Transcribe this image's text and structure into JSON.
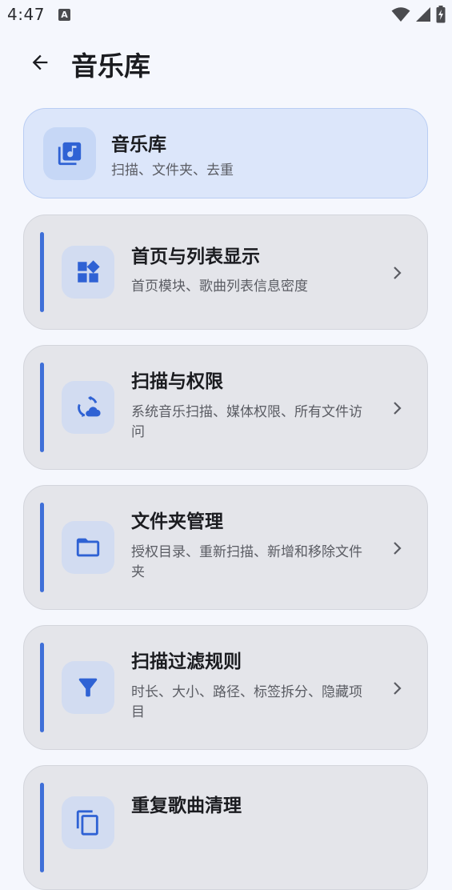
{
  "status_bar": {
    "time": "4:47",
    "notification_letter": "A",
    "icons": [
      "wifi-icon",
      "cellular-signal-icon",
      "battery-charging-icon"
    ]
  },
  "app_bar": {
    "back_icon": "arrow-left-icon",
    "title": "音乐库"
  },
  "accent_color": "#3f6fd8",
  "cards": [
    {
      "title": "音乐库",
      "subtitle": "扫描、文件夹、去重",
      "icon": "music-library-icon",
      "active": true,
      "chevron": false
    },
    {
      "title": "首页与列表显示",
      "subtitle": "首页模块、歌曲列表信息密度",
      "icon": "widgets-icon",
      "active": false,
      "chevron": true
    },
    {
      "title": "扫描与权限",
      "subtitle": "系统音乐扫描、媒体权限、所有文件访问",
      "icon": "cloud-sync-icon",
      "active": false,
      "chevron": true
    },
    {
      "title": "文件夹管理",
      "subtitle": "授权目录、重新扫描、新增和移除文件夹",
      "icon": "folder-icon",
      "active": false,
      "chevron": true
    },
    {
      "title": "扫描过滤规则",
      "subtitle": "时长、大小、路径、标签拆分、隐藏项目",
      "icon": "filter-icon",
      "active": false,
      "chevron": true
    },
    {
      "title": "重复歌曲清理",
      "icon": "duplicate-icon",
      "active": false,
      "chevron": true
    }
  ]
}
